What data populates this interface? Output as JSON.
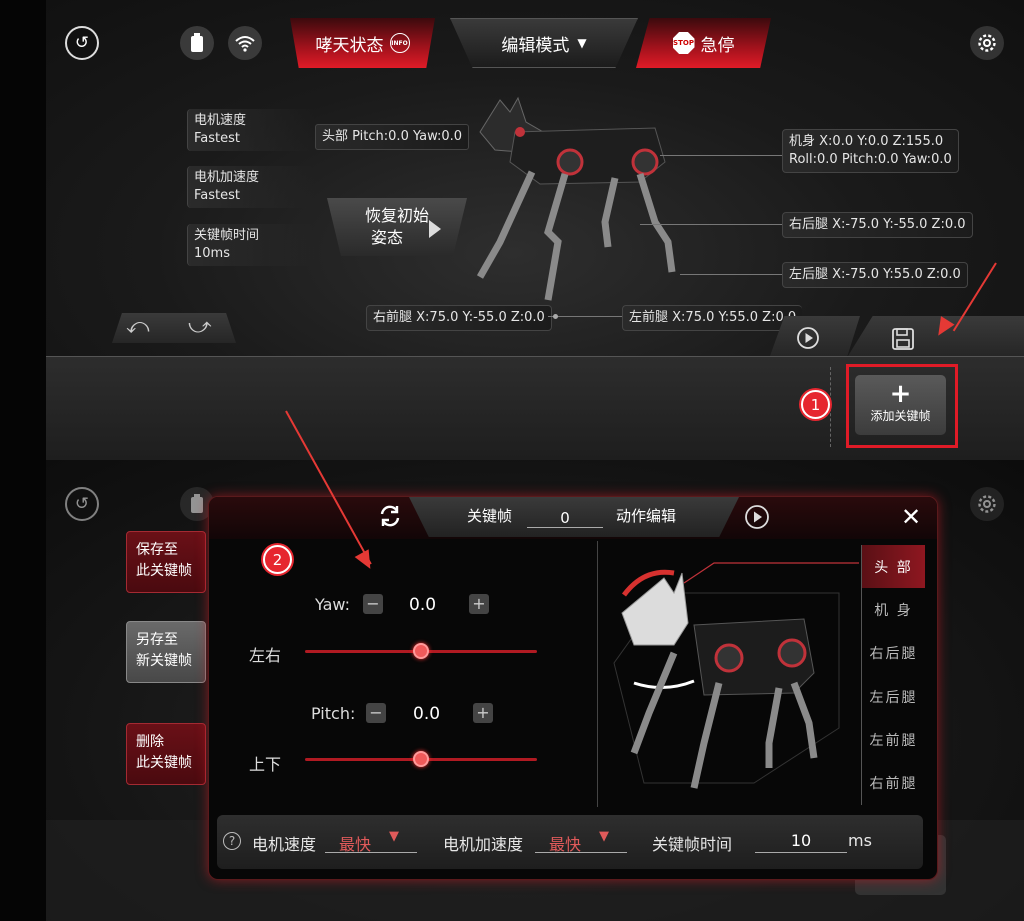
{
  "top": {
    "status_label": "哮天状态",
    "info_badge": "INFO",
    "mode_label": "编辑模式",
    "stop_label": "急停",
    "stop_badge": "STOP"
  },
  "params": [
    {
      "name": "电机速度",
      "value": "Fastest"
    },
    {
      "name": "电机加速度",
      "value": "Fastest"
    },
    {
      "name": "关键帧时间",
      "value": "10ms"
    }
  ],
  "pose": {
    "head": "头部  Pitch:0.0 Yaw:0.0",
    "body_line1": "机身  X:0.0 Y:0.0 Z:155.0",
    "body_line2": "Roll:0.0 Pitch:0.0 Yaw:0.0",
    "rear_right": "右后腿 X:-75.0 Y:-55.0 Z:0.0",
    "rear_left": "左后腿 X:-75.0 Y:55.0 Z:0.0",
    "front_right": "右前腿 X:75.0 Y:-55.0 Z:0.0",
    "front_left": "左前腿 X:75.0 Y:55.0 Z:0.0"
  },
  "restore_label_1": "恢复初始",
  "restore_label_2": "姿态",
  "add_keyframe_label": "添加关键帧",
  "step_numbers": [
    "1",
    "2"
  ],
  "side_buttons": {
    "save_here_1": "保存至",
    "save_here_2": "此关键帧",
    "save_new_1": "另存至",
    "save_new_2": "新关键帧",
    "delete_1": "删除",
    "delete_2": "此关键帧"
  },
  "dialog": {
    "keyframe_label": "关键帧",
    "keyframe_value": "0",
    "action_edit_label": "动作编辑",
    "yaw": {
      "label": "Yaw:",
      "value": "0.0",
      "axis_label": "左右",
      "level": 0.5
    },
    "pitch": {
      "label": "Pitch:",
      "value": "0.0",
      "axis_label": "上下",
      "level": 0.5
    },
    "parts": [
      "头  部",
      "机  身",
      "右后腿",
      "左后腿",
      "左前腿",
      "右前腿"
    ],
    "active_part": 0,
    "motor_speed_label": "电机速度",
    "motor_speed_value": "最快",
    "motor_accel_label": "电机加速度",
    "motor_accel_value": "最快",
    "keyframe_time_label": "关键帧时间",
    "keyframe_time_value": "10",
    "keyframe_time_unit": "ms"
  },
  "colors": {
    "accent": "#e01b27",
    "annotation": "#e53935"
  }
}
